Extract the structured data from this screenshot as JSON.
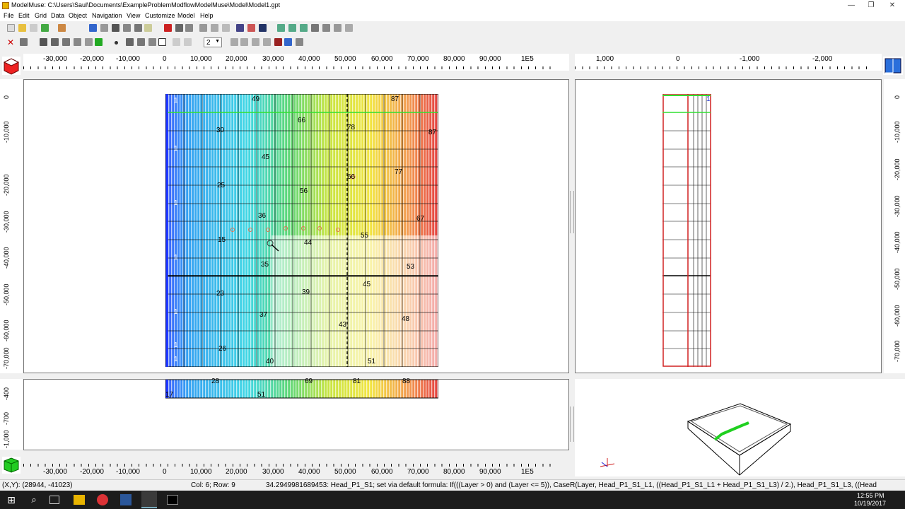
{
  "window": {
    "title": "ModelMuse: C:\\Users\\Saul\\Documents\\ExampleProblemModflowModelMuse\\Model\\Model1.gpt",
    "minimize": "—",
    "maximize": "❐",
    "close": "✕"
  },
  "menu": [
    "File",
    "Edit",
    "Grid",
    "Data",
    "Object",
    "Navigation",
    "View",
    "Customize",
    "Model",
    "Help"
  ],
  "toolbar": {
    "layer_value": "2"
  },
  "top_ruler": {
    "ticks": [
      "-30,000",
      "-20,000",
      "-10,000",
      "0",
      "10,000",
      "20,000",
      "30,000",
      "40,000",
      "50,000",
      "60,000",
      "70,000",
      "80,000",
      "90,000",
      "1E5"
    ]
  },
  "side_ruler": {
    "ticks": [
      "1,000",
      "0",
      "-1,000",
      "-2,000"
    ]
  },
  "left_ruler": {
    "ticks": [
      "0",
      "-10,000",
      "-20,000",
      "-30,000",
      "-40,000",
      "-50,000",
      "-60,000",
      "-70,000"
    ]
  },
  "right_ruler": {
    "ticks": [
      "0",
      "-10,000",
      "-20,000",
      "-30,000",
      "-40,000",
      "-50,000",
      "-60,000",
      "-70,000"
    ]
  },
  "front_ruler": {
    "ticks": [
      "-400",
      "-700",
      "-1,000"
    ]
  },
  "bottom_ruler": {
    "ticks": [
      "-30,000",
      "-20,000",
      "-10,000",
      "0",
      "10,000",
      "20,000",
      "30,000",
      "40,000",
      "50,000",
      "60,000",
      "70,000",
      "80,000",
      "90,000",
      "1E5"
    ]
  },
  "contour_labels": [
    "49",
    "87",
    "66",
    "78",
    "87",
    "30",
    "45",
    "77",
    "66",
    "25",
    "56",
    "36",
    "67",
    "15",
    "44",
    "55",
    "35",
    "53",
    "45",
    "23",
    "39",
    "37",
    "48",
    "43",
    "26",
    "40",
    "51"
  ],
  "row_markers": [
    "1",
    "1",
    "1",
    "1",
    "1",
    "1",
    "1"
  ],
  "front_labels": [
    "28",
    "69",
    "81",
    "88",
    "51",
    "17"
  ],
  "side_label": "1",
  "status": {
    "coords": "(X,Y): (28944, -41023)",
    "cell": "Col: 6; Row: 9",
    "formula": "34.2949981689453: Head_P1_S1; set via default formula: If(((Layer > 0) and (Layer <= 5)), CaseR(Layer, Head_P1_S1_L1, ((Head_P1_S1_L1 + Head_P1_S1_L3) / 2.), Head_P1_S1_L3, ((Head"
  },
  "clock": {
    "time": "12:55 PM",
    "date": "10/19/2017"
  },
  "colors": {
    "low": "#1a40ff",
    "mid_low": "#00c8e8",
    "mid": "#40d040",
    "mid_high": "#e8e800",
    "high": "#e02020"
  }
}
